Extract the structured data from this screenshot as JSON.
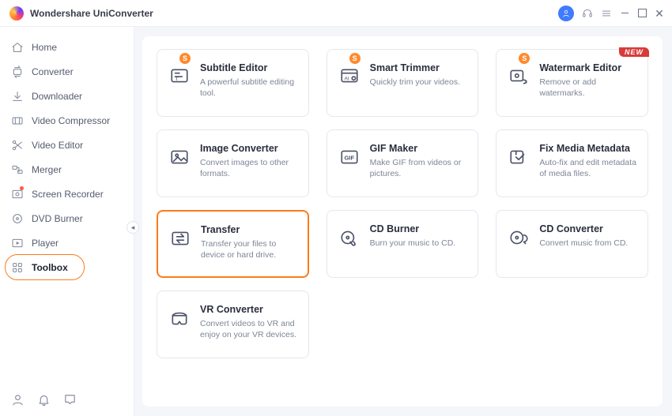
{
  "app": {
    "title": "Wondershare UniConverter"
  },
  "titlebar_icons": {
    "user": "user-avatar",
    "support": "headset-icon",
    "menu": "hamburger-icon"
  },
  "sidebar": {
    "items": [
      {
        "label": "Home",
        "icon": "home-icon"
      },
      {
        "label": "Converter",
        "icon": "converter-icon"
      },
      {
        "label": "Downloader",
        "icon": "download-icon"
      },
      {
        "label": "Video Compressor",
        "icon": "compress-icon"
      },
      {
        "label": "Video Editor",
        "icon": "scissors-icon"
      },
      {
        "label": "Merger",
        "icon": "merger-icon"
      },
      {
        "label": "Screen Recorder",
        "icon": "record-icon",
        "dot": true
      },
      {
        "label": "DVD Burner",
        "icon": "disc-icon"
      },
      {
        "label": "Player",
        "icon": "player-icon"
      },
      {
        "label": "Toolbox",
        "icon": "grid-icon",
        "active": true
      }
    ],
    "bottom": [
      {
        "icon": "user-outline-icon"
      },
      {
        "icon": "bell-icon"
      },
      {
        "icon": "chat-icon"
      }
    ]
  },
  "cards": [
    {
      "title": "Subtitle Editor",
      "desc": "A powerful subtitle editing tool.",
      "icon": "subtitle-icon",
      "badge": "S"
    },
    {
      "title": "Smart Trimmer",
      "desc": "Quickly trim your videos.",
      "icon": "ai-trim-icon",
      "badge": "S"
    },
    {
      "title": "Watermark Editor",
      "desc": "Remove or add watermarks.",
      "icon": "watermark-icon",
      "badge": "S",
      "new": true
    },
    {
      "title": "Image Converter",
      "desc": "Convert images to other formats.",
      "icon": "image-icon"
    },
    {
      "title": "GIF Maker",
      "desc": "Make GIF from videos or pictures.",
      "icon": "gif-icon"
    },
    {
      "title": "Fix Media Metadata",
      "desc": "Auto-fix and edit metadata of media files.",
      "icon": "metadata-icon"
    },
    {
      "title": "Transfer",
      "desc": "Transfer your files to device or hard drive.",
      "icon": "transfer-icon",
      "selected": true
    },
    {
      "title": "CD Burner",
      "desc": "Burn your music to CD.",
      "icon": "cd-burn-icon"
    },
    {
      "title": "CD Converter",
      "desc": "Convert music from CD.",
      "icon": "cd-conv-icon"
    },
    {
      "title": "VR Converter",
      "desc": "Convert videos to VR and enjoy on your VR devices.",
      "icon": "vr-icon"
    }
  ],
  "labels": {
    "badge_s": "S",
    "new": "NEW"
  }
}
